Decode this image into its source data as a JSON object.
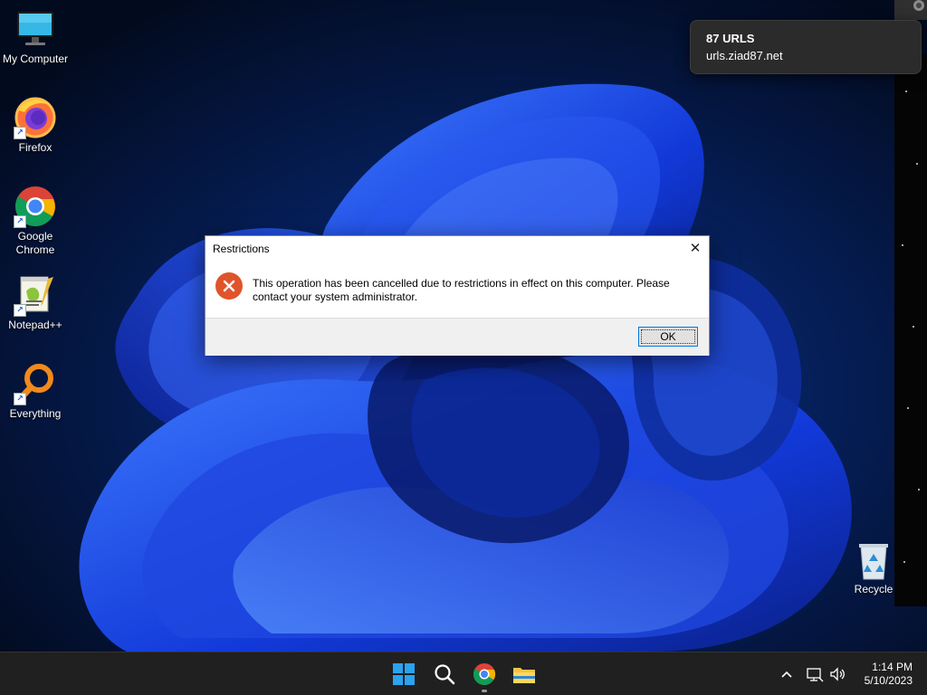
{
  "desktop": {
    "icons": [
      {
        "label": "My Computer",
        "icon": "monitor-icon"
      },
      {
        "label": "Firefox",
        "icon": "firefox-icon"
      },
      {
        "label": "Google Chrome",
        "icon": "chrome-icon"
      },
      {
        "label": "Notepad++",
        "icon": "notepadpp-icon"
      },
      {
        "label": "Everything",
        "icon": "everything-search-icon"
      },
      {
        "label": "Recycle",
        "icon": "recycle-bin-icon"
      }
    ]
  },
  "toast": {
    "title": "87 URLS",
    "body": "urls.ziad87.net"
  },
  "dialog": {
    "title": "Restrictions",
    "close_label": "✕",
    "message": "This operation has been cancelled due to restrictions in effect on this computer. Please contact your system administrator.",
    "ok_label": "OK",
    "icon": "error-icon"
  },
  "taskbar": {
    "apps": [
      "windows-start-icon",
      "search-icon",
      "chrome-icon",
      "file-explorer-icon"
    ],
    "tray": [
      "chevron-up-icon",
      "network-icon",
      "volume-icon"
    ],
    "time": "1:14 PM",
    "date": "5/10/2023"
  },
  "colors": {
    "taskbar_bg": "#202020",
    "toast_bg": "#2b2b2b",
    "error_red": "#e0542b",
    "accent_blue": "#0078d7"
  }
}
